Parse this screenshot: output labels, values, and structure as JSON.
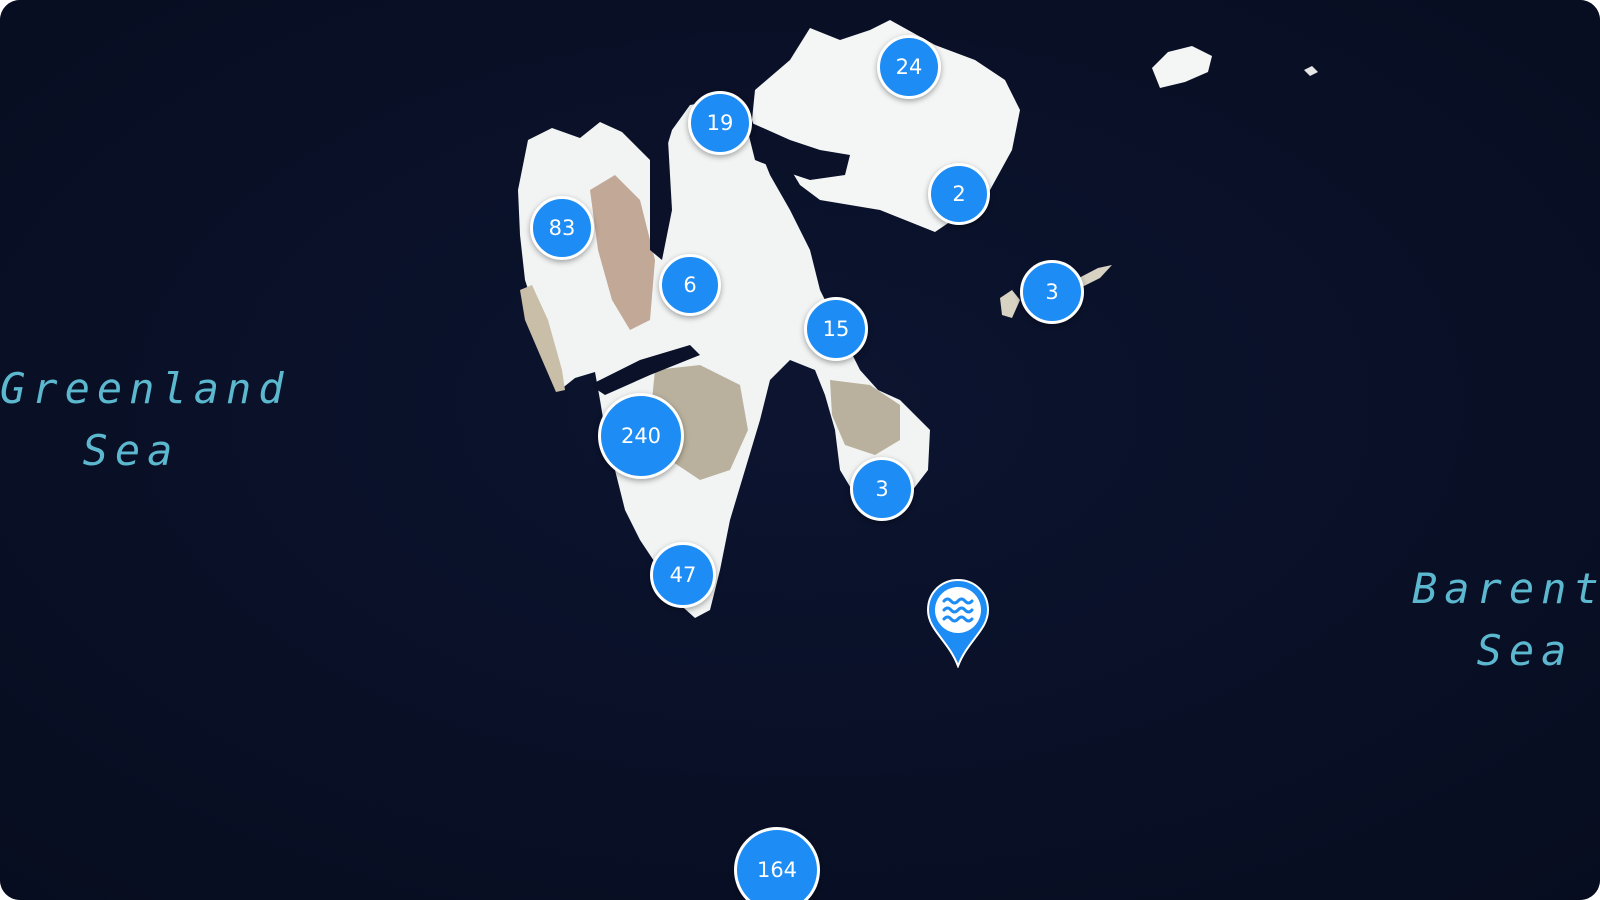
{
  "map": {
    "colors": {
      "ocean": "#0a1128",
      "marker": "#1e8cf5",
      "label": "#5cb8cf",
      "snow": "#f4f5f5"
    },
    "sea_labels": {
      "greenland": {
        "line1": "Greenland",
        "line2": "Sea"
      },
      "barents": {
        "line1": "Barents",
        "line2": "Sea"
      }
    },
    "clusters": [
      {
        "id": "24",
        "count": "24"
      },
      {
        "id": "19",
        "count": "19"
      },
      {
        "id": "2",
        "count": "2"
      },
      {
        "id": "83",
        "count": "83"
      },
      {
        "id": "6",
        "count": "6"
      },
      {
        "id": "3-east",
        "count": "3"
      },
      {
        "id": "15",
        "count": "15"
      },
      {
        "id": "240",
        "count": "240"
      },
      {
        "id": "3-south",
        "count": "3"
      },
      {
        "id": "47",
        "count": "47"
      },
      {
        "id": "164",
        "count": "164"
      }
    ],
    "pin": {
      "icon": "waves-icon"
    }
  }
}
